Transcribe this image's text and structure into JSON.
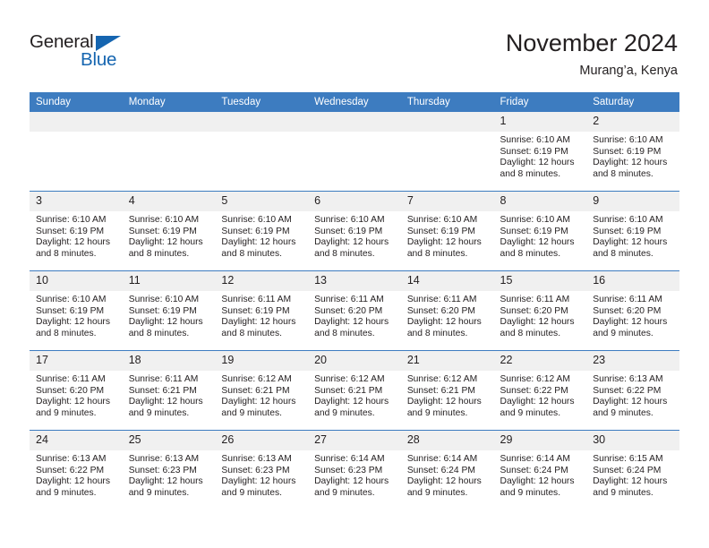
{
  "logo": {
    "word_one": "General",
    "word_two": "Blue",
    "accent_color": "#1565b0",
    "triangle_icon": "triangle-icon"
  },
  "header": {
    "title": "November 2024",
    "subtitle": "Murang’a, Kenya",
    "header_bg_color": "#3d7cc0"
  },
  "columns": [
    "Sunday",
    "Monday",
    "Tuesday",
    "Wednesday",
    "Thursday",
    "Friday",
    "Saturday"
  ],
  "weeks": [
    [
      {
        "day": "",
        "sunrise": "",
        "sunset": "",
        "daylight": ""
      },
      {
        "day": "",
        "sunrise": "",
        "sunset": "",
        "daylight": ""
      },
      {
        "day": "",
        "sunrise": "",
        "sunset": "",
        "daylight": ""
      },
      {
        "day": "",
        "sunrise": "",
        "sunset": "",
        "daylight": ""
      },
      {
        "day": "",
        "sunrise": "",
        "sunset": "",
        "daylight": ""
      },
      {
        "day": "1",
        "sunrise": "Sunrise: 6:10 AM",
        "sunset": "Sunset: 6:19 PM",
        "daylight": "Daylight: 12 hours and 8 minutes."
      },
      {
        "day": "2",
        "sunrise": "Sunrise: 6:10 AM",
        "sunset": "Sunset: 6:19 PM",
        "daylight": "Daylight: 12 hours and 8 minutes."
      }
    ],
    [
      {
        "day": "3",
        "sunrise": "Sunrise: 6:10 AM",
        "sunset": "Sunset: 6:19 PM",
        "daylight": "Daylight: 12 hours and 8 minutes."
      },
      {
        "day": "4",
        "sunrise": "Sunrise: 6:10 AM",
        "sunset": "Sunset: 6:19 PM",
        "daylight": "Daylight: 12 hours and 8 minutes."
      },
      {
        "day": "5",
        "sunrise": "Sunrise: 6:10 AM",
        "sunset": "Sunset: 6:19 PM",
        "daylight": "Daylight: 12 hours and 8 minutes."
      },
      {
        "day": "6",
        "sunrise": "Sunrise: 6:10 AM",
        "sunset": "Sunset: 6:19 PM",
        "daylight": "Daylight: 12 hours and 8 minutes."
      },
      {
        "day": "7",
        "sunrise": "Sunrise: 6:10 AM",
        "sunset": "Sunset: 6:19 PM",
        "daylight": "Daylight: 12 hours and 8 minutes."
      },
      {
        "day": "8",
        "sunrise": "Sunrise: 6:10 AM",
        "sunset": "Sunset: 6:19 PM",
        "daylight": "Daylight: 12 hours and 8 minutes."
      },
      {
        "day": "9",
        "sunrise": "Sunrise: 6:10 AM",
        "sunset": "Sunset: 6:19 PM",
        "daylight": "Daylight: 12 hours and 8 minutes."
      }
    ],
    [
      {
        "day": "10",
        "sunrise": "Sunrise: 6:10 AM",
        "sunset": "Sunset: 6:19 PM",
        "daylight": "Daylight: 12 hours and 8 minutes."
      },
      {
        "day": "11",
        "sunrise": "Sunrise: 6:10 AM",
        "sunset": "Sunset: 6:19 PM",
        "daylight": "Daylight: 12 hours and 8 minutes."
      },
      {
        "day": "12",
        "sunrise": "Sunrise: 6:11 AM",
        "sunset": "Sunset: 6:19 PM",
        "daylight": "Daylight: 12 hours and 8 minutes."
      },
      {
        "day": "13",
        "sunrise": "Sunrise: 6:11 AM",
        "sunset": "Sunset: 6:20 PM",
        "daylight": "Daylight: 12 hours and 8 minutes."
      },
      {
        "day": "14",
        "sunrise": "Sunrise: 6:11 AM",
        "sunset": "Sunset: 6:20 PM",
        "daylight": "Daylight: 12 hours and 8 minutes."
      },
      {
        "day": "15",
        "sunrise": "Sunrise: 6:11 AM",
        "sunset": "Sunset: 6:20 PM",
        "daylight": "Daylight: 12 hours and 8 minutes."
      },
      {
        "day": "16",
        "sunrise": "Sunrise: 6:11 AM",
        "sunset": "Sunset: 6:20 PM",
        "daylight": "Daylight: 12 hours and 9 minutes."
      }
    ],
    [
      {
        "day": "17",
        "sunrise": "Sunrise: 6:11 AM",
        "sunset": "Sunset: 6:20 PM",
        "daylight": "Daylight: 12 hours and 9 minutes."
      },
      {
        "day": "18",
        "sunrise": "Sunrise: 6:11 AM",
        "sunset": "Sunset: 6:21 PM",
        "daylight": "Daylight: 12 hours and 9 minutes."
      },
      {
        "day": "19",
        "sunrise": "Sunrise: 6:12 AM",
        "sunset": "Sunset: 6:21 PM",
        "daylight": "Daylight: 12 hours and 9 minutes."
      },
      {
        "day": "20",
        "sunrise": "Sunrise: 6:12 AM",
        "sunset": "Sunset: 6:21 PM",
        "daylight": "Daylight: 12 hours and 9 minutes."
      },
      {
        "day": "21",
        "sunrise": "Sunrise: 6:12 AM",
        "sunset": "Sunset: 6:21 PM",
        "daylight": "Daylight: 12 hours and 9 minutes."
      },
      {
        "day": "22",
        "sunrise": "Sunrise: 6:12 AM",
        "sunset": "Sunset: 6:22 PM",
        "daylight": "Daylight: 12 hours and 9 minutes."
      },
      {
        "day": "23",
        "sunrise": "Sunrise: 6:13 AM",
        "sunset": "Sunset: 6:22 PM",
        "daylight": "Daylight: 12 hours and 9 minutes."
      }
    ],
    [
      {
        "day": "24",
        "sunrise": "Sunrise: 6:13 AM",
        "sunset": "Sunset: 6:22 PM",
        "daylight": "Daylight: 12 hours and 9 minutes."
      },
      {
        "day": "25",
        "sunrise": "Sunrise: 6:13 AM",
        "sunset": "Sunset: 6:23 PM",
        "daylight": "Daylight: 12 hours and 9 minutes."
      },
      {
        "day": "26",
        "sunrise": "Sunrise: 6:13 AM",
        "sunset": "Sunset: 6:23 PM",
        "daylight": "Daylight: 12 hours and 9 minutes."
      },
      {
        "day": "27",
        "sunrise": "Sunrise: 6:14 AM",
        "sunset": "Sunset: 6:23 PM",
        "daylight": "Daylight: 12 hours and 9 minutes."
      },
      {
        "day": "28",
        "sunrise": "Sunrise: 6:14 AM",
        "sunset": "Sunset: 6:24 PM",
        "daylight": "Daylight: 12 hours and 9 minutes."
      },
      {
        "day": "29",
        "sunrise": "Sunrise: 6:14 AM",
        "sunset": "Sunset: 6:24 PM",
        "daylight": "Daylight: 12 hours and 9 minutes."
      },
      {
        "day": "30",
        "sunrise": "Sunrise: 6:15 AM",
        "sunset": "Sunset: 6:24 PM",
        "daylight": "Daylight: 12 hours and 9 minutes."
      }
    ]
  ]
}
